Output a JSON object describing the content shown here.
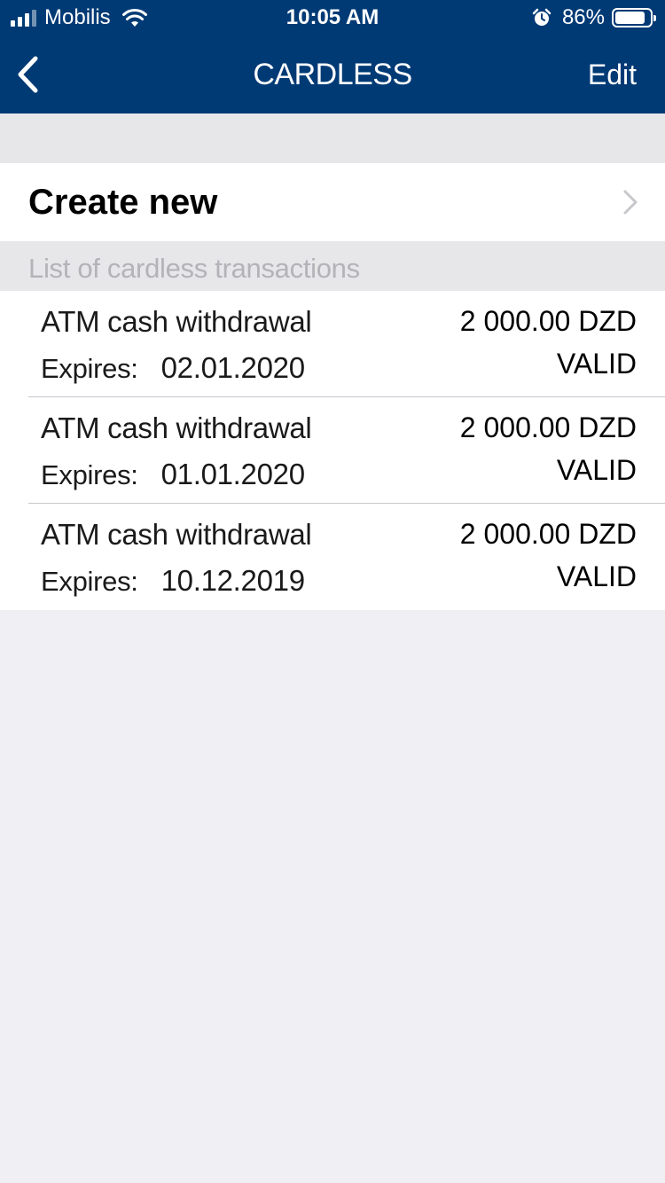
{
  "status_bar": {
    "carrier": "Mobilis",
    "time": "10:05 AM",
    "battery_percent_label": "86%",
    "battery_level": 0.86
  },
  "nav": {
    "title": "CARDLESS",
    "edit_label": "Edit"
  },
  "create_new": {
    "label": "Create new"
  },
  "section": {
    "header": "List of cardless transactions"
  },
  "transactions": [
    {
      "name": "ATM cash withdrawal",
      "expires_label": "Expires:",
      "expires_date": "02.01.2020",
      "amount": "2 000.00 DZD",
      "status": "VALID"
    },
    {
      "name": "ATM cash withdrawal",
      "expires_label": "Expires:",
      "expires_date": "01.01.2020",
      "amount": "2 000.00 DZD",
      "status": "VALID"
    },
    {
      "name": "ATM cash withdrawal",
      "expires_label": "Expires:",
      "expires_date": "10.12.2019",
      "amount": "2 000.00 DZD",
      "status": "VALID"
    }
  ],
  "colors": {
    "nav_background": "#003a75",
    "page_background": "#efeff4",
    "section_background": "#e7e7e9",
    "section_text": "#b3b3b8"
  },
  "icons": {
    "signal": "cellular-signal-icon",
    "wifi": "wifi-icon",
    "alarm": "alarm-clock-icon",
    "battery": "battery-icon",
    "back": "chevron-left-icon",
    "disclosure": "chevron-right-icon"
  }
}
